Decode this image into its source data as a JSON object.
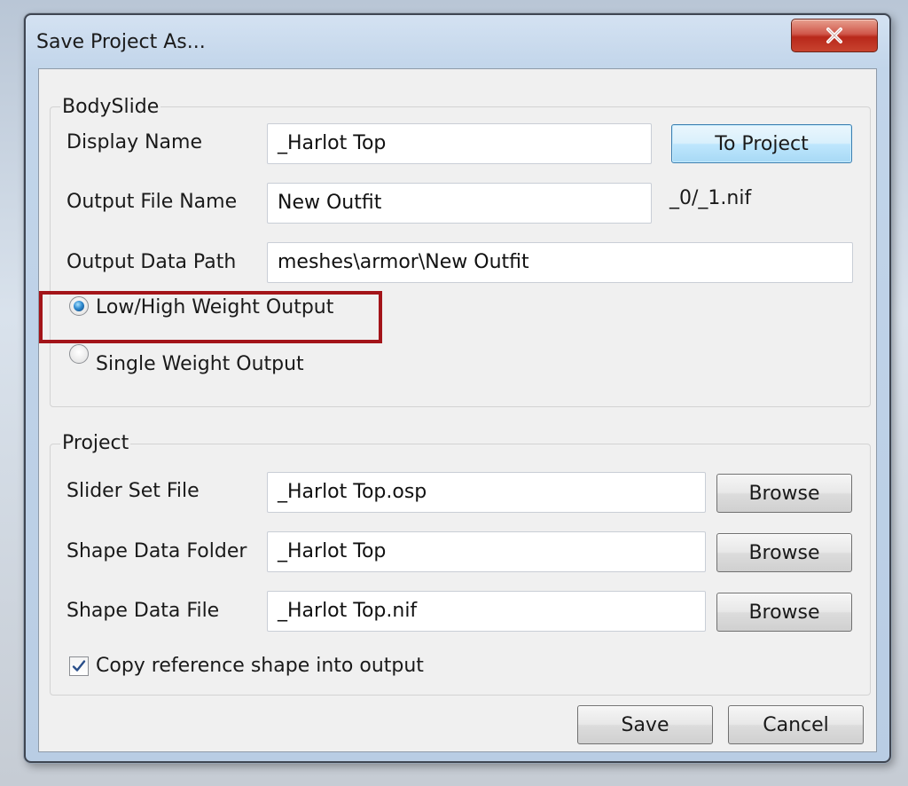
{
  "window": {
    "title": "Save Project As..."
  },
  "bodyslide": {
    "group_label": "BodySlide",
    "display_name": {
      "label": "Display Name",
      "value": "_Harlot Top"
    },
    "to_project_label": "To Project",
    "output_file_name": {
      "label": "Output File Name",
      "value": "New Outfit",
      "suffix": "_0/_1.nif"
    },
    "output_data_path": {
      "label": "Output Data Path",
      "value": "meshes\\armor\\New Outfit"
    },
    "weight_options": [
      {
        "label": "Low/High Weight Output",
        "selected": true
      },
      {
        "label": "Single Weight Output",
        "selected": false
      }
    ]
  },
  "project": {
    "group_label": "Project",
    "slider_set_file": {
      "label": "Slider Set File",
      "value": "_Harlot Top.osp",
      "browse_label": "Browse"
    },
    "shape_data_folder": {
      "label": "Shape Data Folder",
      "value": "_Harlot Top",
      "browse_label": "Browse"
    },
    "shape_data_file": {
      "label": "Shape Data File",
      "value": "_Harlot Top.nif",
      "browse_label": "Browse"
    },
    "copy_reference": {
      "label": "Copy reference shape into output",
      "checked": true
    }
  },
  "footer": {
    "save_label": "Save",
    "cancel_label": "Cancel"
  },
  "colors": {
    "highlight_box": "#a31419",
    "close_button": "#c8432f",
    "accent": "#3c7fb1"
  },
  "icons": {
    "close": "close-icon",
    "checkmark": "checkmark-icon",
    "radio": "radio-icon"
  }
}
